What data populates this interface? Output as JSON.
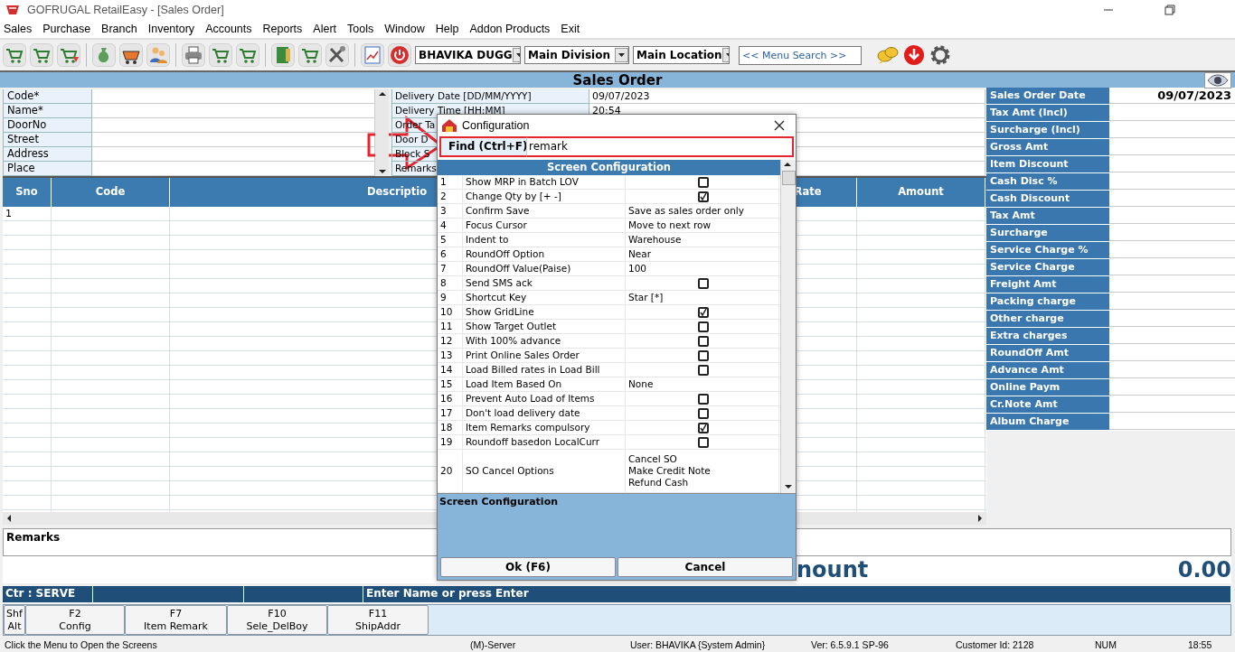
{
  "window": {
    "title": "GOFRUGAL RetailEasy - [Sales Order]"
  },
  "menu": [
    "Sales",
    "Purchase",
    "Branch",
    "Inventory",
    "Accounts",
    "Reports",
    "Alert",
    "Tools",
    "Window",
    "Help",
    "Addon Products",
    "Exit"
  ],
  "toolbar": {
    "user": "BHAVIKA DUGG",
    "division": "Main Division",
    "location": "Main Location",
    "menu_search": {
      "placeholder": "<< Menu Search >>"
    }
  },
  "form": {
    "title": "Sales Order",
    "customer_fields": [
      {
        "label": "Code*"
      },
      {
        "label": "Name*"
      },
      {
        "label": "DoorNo"
      },
      {
        "label": "Street"
      },
      {
        "label": "Address"
      },
      {
        "label": "Place"
      }
    ],
    "delivery_fields": [
      {
        "label": "Delivery Date [DD/MM/YYYY]",
        "value": "09/07/2023"
      },
      {
        "label": "Delivery Time [HH:MM]",
        "value": "20:54"
      },
      {
        "label": "Order Ta"
      },
      {
        "label": "Door D"
      },
      {
        "label": "Block S"
      },
      {
        "label": "Remarks"
      }
    ]
  },
  "grid": {
    "columns": [
      "Sno",
      "Code",
      "Descriptio",
      "Rate",
      "Amount"
    ],
    "rows": [
      {
        "sno": "1"
      }
    ]
  },
  "summary": [
    {
      "label": "Sales Order Date",
      "value": "09/07/2023"
    },
    {
      "label": "Tax Amt (Incl)"
    },
    {
      "label": "Surcharge (Incl)"
    },
    {
      "label": "Gross Amt"
    },
    {
      "label": "Item Discount"
    },
    {
      "label": "Cash Disc %"
    },
    {
      "label": "Cash Discount"
    },
    {
      "label": "Tax Amt"
    },
    {
      "label": "Surcharge"
    },
    {
      "label": "Service Charge %"
    },
    {
      "label": "Service Charge"
    },
    {
      "label": "Freight Amt"
    },
    {
      "label": "Packing charge"
    },
    {
      "label": "Other charge"
    },
    {
      "label": "Extra charges"
    },
    {
      "label": "RoundOff Amt"
    },
    {
      "label": "Advance Amt"
    },
    {
      "label": "Online Paym"
    },
    {
      "label": "Cr.Note Amt"
    },
    {
      "label": "Album Charge"
    }
  ],
  "remarks": {
    "label": "Remarks"
  },
  "total": {
    "label": "nount",
    "value": "0.00"
  },
  "status_strip": {
    "counter": "Ctr : SERVE",
    "prompt": "Enter Name or press Enter"
  },
  "function_keys": {
    "modifiers": [
      "Shf",
      "Alt"
    ],
    "keys": [
      {
        "key": "F2",
        "label": "Config"
      },
      {
        "key": "F7",
        "label": "Item Remark"
      },
      {
        "key": "F10",
        "label": "Sele_DelBoy"
      },
      {
        "key": "F11",
        "label": "ShipAddr"
      }
    ]
  },
  "status_bar": [
    "Click the Menu to Open the Screens",
    "(M)-Server",
    "User: BHAVIKA {System Admin}",
    "Ver: 6.5.9.1 SP-96",
    "Customer Id: 2128",
    "NUM",
    "18:55"
  ],
  "dialog": {
    "title": "Configuration",
    "find": {
      "label": "Find (Ctrl+F)",
      "value": "remark"
    },
    "header": "Screen Configuration",
    "rows": [
      {
        "no": "1",
        "name": "Show MRP in Batch LOV",
        "kind": "checkbox",
        "checked": false
      },
      {
        "no": "2",
        "name": "Change Qty by [+ -]",
        "kind": "checkbox",
        "checked": true
      },
      {
        "no": "3",
        "name": "Confirm Save",
        "kind": "text",
        "value": "Save as sales order only"
      },
      {
        "no": "4",
        "name": "Focus Cursor",
        "kind": "text",
        "value": "Move to next row"
      },
      {
        "no": "5",
        "name": "Indent to",
        "kind": "text",
        "value": "Warehouse"
      },
      {
        "no": "6",
        "name": "RoundOff Option",
        "kind": "text",
        "value": "Near"
      },
      {
        "no": "7",
        "name": "RoundOff Value(Paise)",
        "kind": "text",
        "value": "100"
      },
      {
        "no": "8",
        "name": "Send SMS ack",
        "kind": "checkbox",
        "checked": false
      },
      {
        "no": "9",
        "name": "Shortcut Key",
        "kind": "text",
        "value": "Star [*]"
      },
      {
        "no": "10",
        "name": "Show GridLine",
        "kind": "checkbox",
        "checked": true
      },
      {
        "no": "11",
        "name": "Show Target Outlet",
        "kind": "checkbox",
        "checked": false
      },
      {
        "no": "12",
        "name": "With 100% advance",
        "kind": "checkbox",
        "checked": false
      },
      {
        "no": "13",
        "name": "Print Online Sales Order",
        "kind": "checkbox",
        "checked": false
      },
      {
        "no": "14",
        "name": "Load Billed rates in Load Bill",
        "kind": "checkbox",
        "checked": false
      },
      {
        "no": "15",
        "name": "Load Item Based On",
        "kind": "text",
        "value": "None"
      },
      {
        "no": "16",
        "name": "Prevent Auto Load of Items",
        "kind": "checkbox",
        "checked": false
      },
      {
        "no": "17",
        "name": "Don't load delivery date",
        "kind": "checkbox",
        "checked": false
      },
      {
        "no": "18",
        "name": "Item Remarks compulsory",
        "kind": "checkbox",
        "checked": true
      },
      {
        "no": "19",
        "name": "Roundoff basedon LocalCurr",
        "kind": "checkbox",
        "checked": false
      },
      {
        "no": "20",
        "name": "SO Cancel Options",
        "kind": "lines",
        "values": [
          "Cancel SO",
          "Make Credit Note",
          "Refund Cash"
        ]
      }
    ],
    "description": "Screen Configuration",
    "buttons": [
      "Ok (F6)",
      "Cancel"
    ]
  }
}
